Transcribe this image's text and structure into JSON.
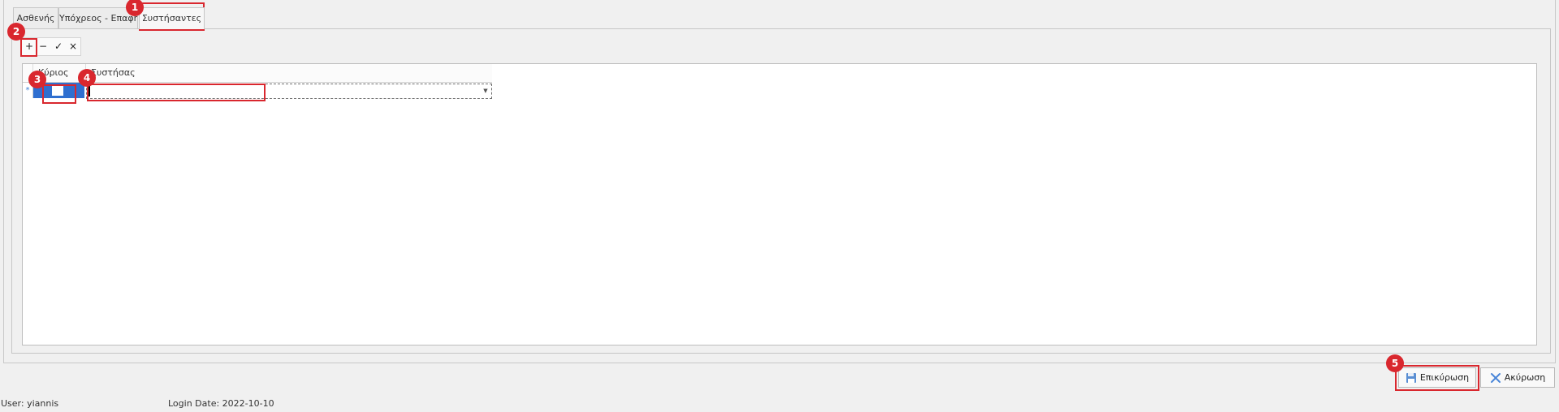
{
  "tabs": [
    {
      "label": "Ασθενής"
    },
    {
      "label": "Υπόχρεος - Επαφή"
    },
    {
      "label": "Συστήσαντες",
      "active": true
    }
  ],
  "toolbar": {
    "add": "+",
    "remove": "−",
    "confirm": "✓",
    "cancel": "×"
  },
  "grid": {
    "columns": [
      "Κύριος",
      "Συστήσας"
    ],
    "new_row_indicator": "*",
    "new_row": {
      "primary_checked": false,
      "referrer_value": ""
    }
  },
  "callouts": [
    "1",
    "2",
    "3",
    "4",
    "5"
  ],
  "buttons": {
    "save": "Επικύρωση",
    "cancel": "Ακύρωση"
  },
  "status": {
    "user": "User: yiannis",
    "login_date": "Login Date: 2022-10-10"
  },
  "colors": {
    "highlight": "#d9272e",
    "selection": "#2f6fd0"
  },
  "icons": {
    "save": "floppy-disk-icon",
    "cancel": "x-icon"
  }
}
